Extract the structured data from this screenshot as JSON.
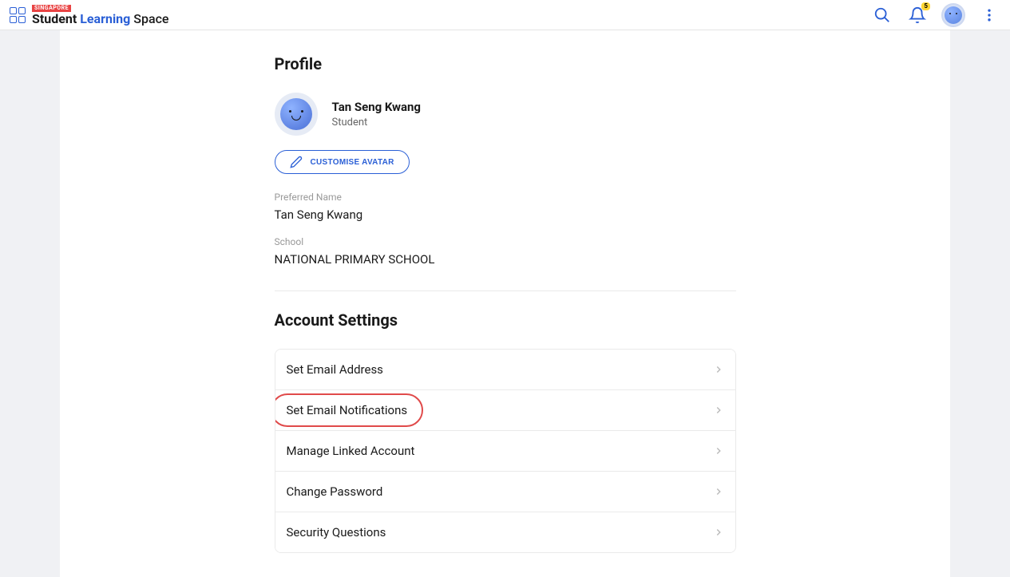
{
  "header": {
    "logo_tag": "SINGAPORE",
    "logo_word1": "Student",
    "logo_word2": "Learning",
    "logo_word3": "Space",
    "notification_count": "5"
  },
  "profile": {
    "section_title": "Profile",
    "name": "Tan Seng Kwang",
    "role": "Student",
    "customise_button": "CUSTOMISE AVATAR",
    "preferred_name_label": "Preferred Name",
    "preferred_name_value": "Tan Seng Kwang",
    "school_label": "School",
    "school_value": "NATIONAL PRIMARY SCHOOL"
  },
  "account_settings": {
    "section_title": "Account Settings",
    "items": [
      {
        "label": "Set Email Address"
      },
      {
        "label": "Set Email Notifications"
      },
      {
        "label": "Manage Linked Account"
      },
      {
        "label": "Change Password"
      },
      {
        "label": "Security Questions"
      }
    ]
  }
}
